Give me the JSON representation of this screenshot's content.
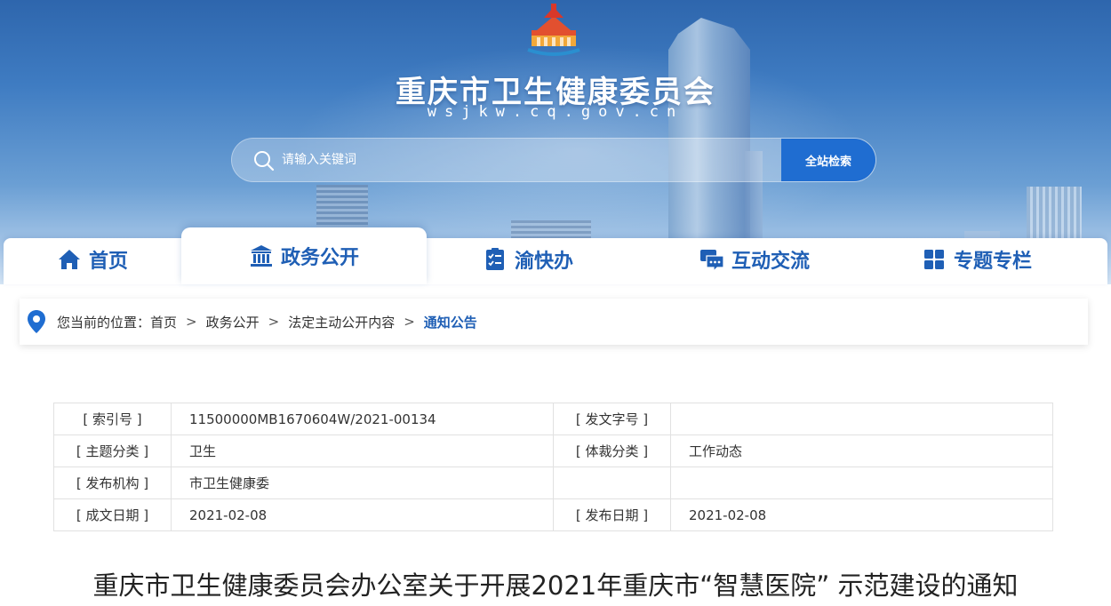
{
  "header": {
    "site_title": "重庆市卫生健康委员会",
    "site_domain": "wsjkw.cq.gov.cn",
    "search": {
      "placeholder": "请输入关键词",
      "button_label": "全站检索"
    }
  },
  "nav": {
    "items": [
      {
        "label": "首页",
        "icon": "home-icon",
        "active": false
      },
      {
        "label": "政务公开",
        "icon": "government-building-icon",
        "active": true
      },
      {
        "label": "渝快办",
        "icon": "checklist-icon",
        "active": false
      },
      {
        "label": "互动交流",
        "icon": "chat-bubble-icon",
        "active": false
      },
      {
        "label": "专题专栏",
        "icon": "grid-icon",
        "active": false
      }
    ]
  },
  "breadcrumb": {
    "prefix": "您当前的位置：",
    "items": [
      "首页",
      "政务公开",
      "法定主动公开内容",
      "通知公告"
    ],
    "separator": ">"
  },
  "info_table": {
    "rows": [
      {
        "label1": "[ 索引号 ]",
        "value1": "11500000MB1670604W/2021-00134",
        "label2": "[ 发文字号 ]",
        "value2": ""
      },
      {
        "label1": "[ 主题分类 ]",
        "value1": "卫生",
        "label2": "[ 体裁分类 ]",
        "value2": "工作动态"
      },
      {
        "label1": "[ 发布机构 ]",
        "value1": "市卫生健康委",
        "label2": "",
        "value2": ""
      },
      {
        "label1": "[ 成文日期 ]",
        "value1": "2021-02-08",
        "label2": "[ 发布日期 ]",
        "value2": "2021-02-08"
      }
    ]
  },
  "article": {
    "title": "重庆市卫生健康委员会办公室关于开展2021年重庆市“智慧医院” 示范建设的通知"
  },
  "colors": {
    "accent": "#1f5fb5",
    "search_button": "#1f6dd1",
    "banner_top": "#2e66ad"
  }
}
